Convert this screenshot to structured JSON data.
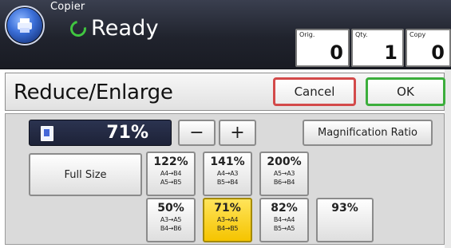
{
  "header": {
    "app_name": "Copier",
    "status": "Ready",
    "counters": [
      {
        "label": "Orig.",
        "value": "0"
      },
      {
        "label": "Qty.",
        "value": "1"
      },
      {
        "label": "Copy",
        "value": "0"
      }
    ]
  },
  "titlebar": {
    "title": "Reduce/Enlarge",
    "cancel_label": "Cancel",
    "ok_label": "OK"
  },
  "controls": {
    "current_ratio": "71%",
    "minus_label": "−",
    "plus_label": "+",
    "magnification_label": "Magnification Ratio",
    "full_size_label": "Full Size"
  },
  "presets": [
    {
      "pct": "122%",
      "line1": "A4→B4",
      "line2": "A5→B5"
    },
    {
      "pct": "141%",
      "line1": "A4→A3",
      "line2": "B5→B4"
    },
    {
      "pct": "200%",
      "line1": "A5→A3",
      "line2": "B6→B4"
    },
    {
      "pct": "50%",
      "line1": "A3→A5",
      "line2": "B4→B6"
    },
    {
      "pct": "71%",
      "line1": "A3→A4",
      "line2": "B4→B5"
    },
    {
      "pct": "82%",
      "line1": "B4→A4",
      "line2": "B5→A5"
    },
    {
      "pct": "93%",
      "line1": "",
      "line2": ""
    }
  ],
  "colors": {
    "header_bg": "#20232d",
    "cancel_border": "#d34a4a",
    "ok_border": "#3cae3c",
    "selected": "#f5c400",
    "status_icon": "#40c640"
  }
}
